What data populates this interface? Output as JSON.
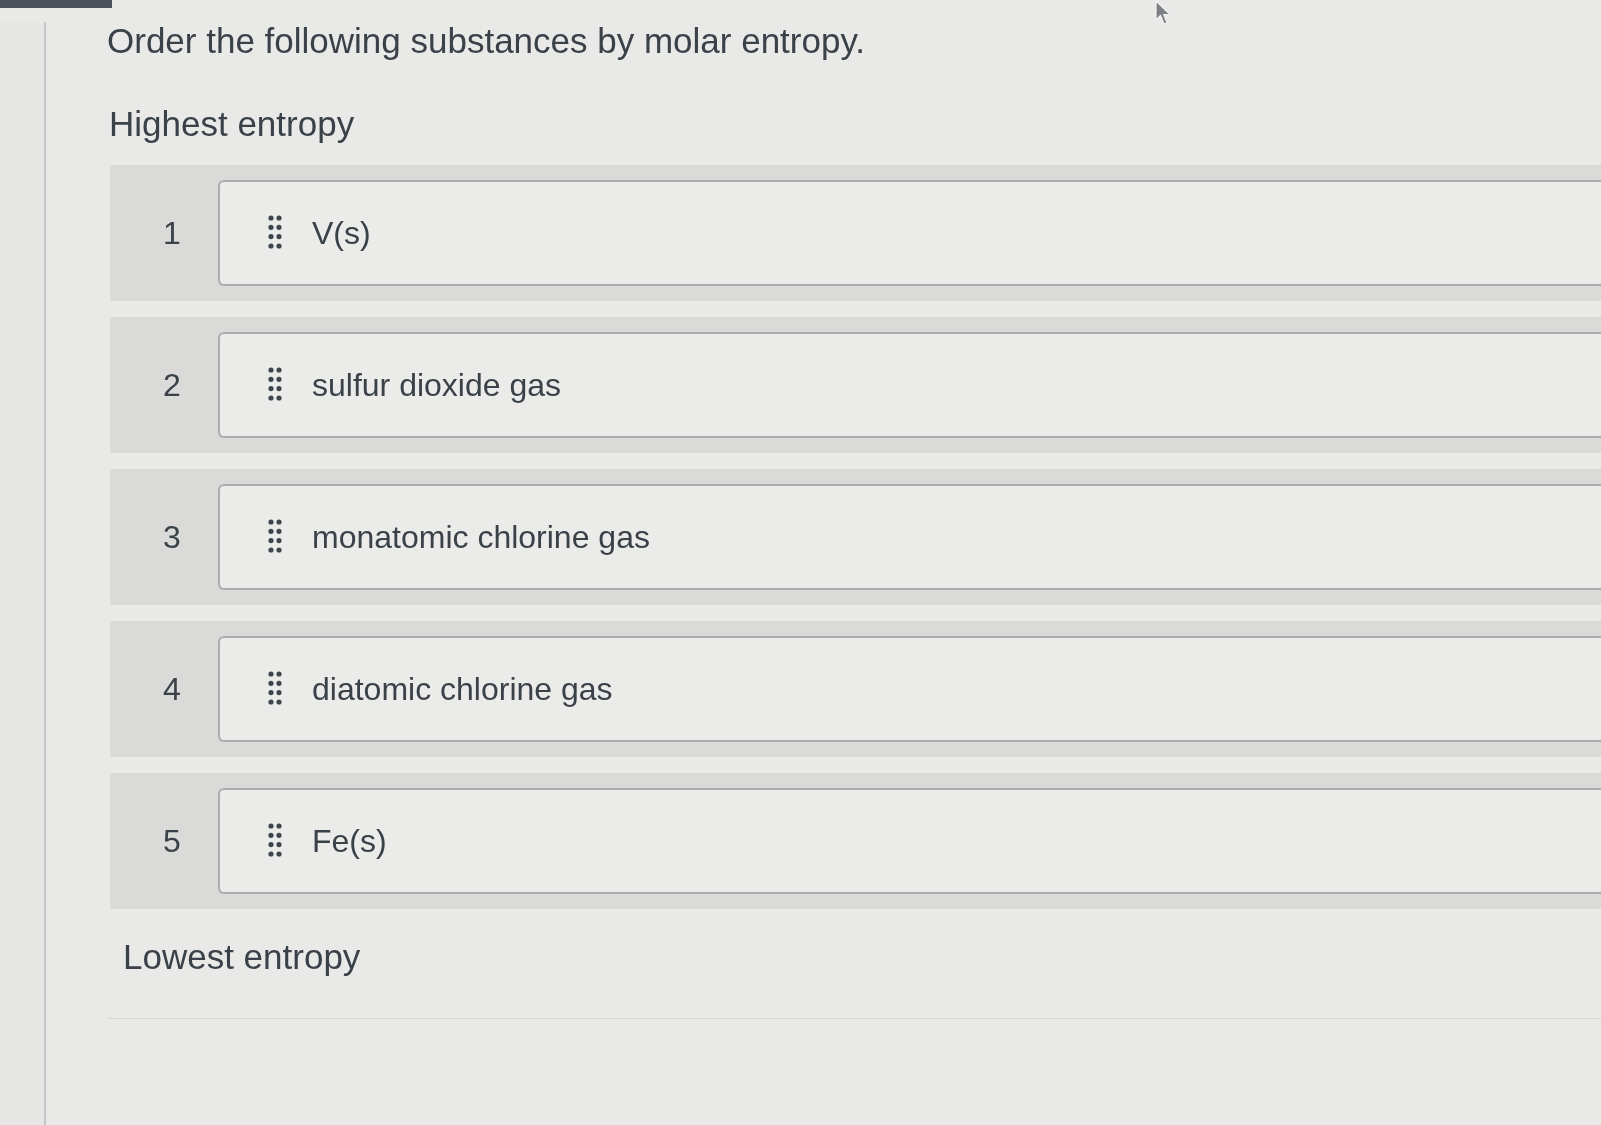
{
  "question": {
    "prompt": "Order the following substances by molar entropy.",
    "top_label": "Highest entropy",
    "items": [
      {
        "rank": "1",
        "label": "V(s)"
      },
      {
        "rank": "2",
        "label": "sulfur dioxide gas"
      },
      {
        "rank": "3",
        "label": "monatomic chlorine gas"
      },
      {
        "rank": "4",
        "label": "diatomic chlorine gas"
      },
      {
        "rank": "5",
        "label": "Fe(s)"
      }
    ],
    "bottom_label": "Lowest entropy"
  }
}
